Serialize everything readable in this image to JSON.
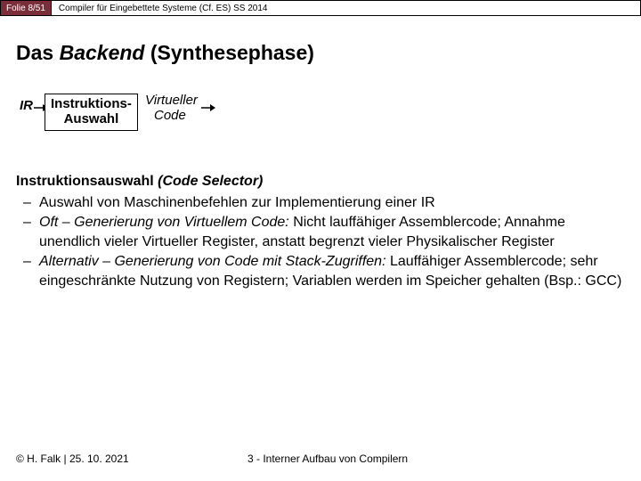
{
  "header": {
    "page_num": "Folie 8/51",
    "course": "Compiler für Eingebettete Systeme (Cf. ES) SS 2014"
  },
  "title_prefix": "Das ",
  "title_em": "Backend",
  "title_suffix": " (Synthesephase)",
  "diagram": {
    "ir": "IR",
    "box_line1": "Instruktions-",
    "box_line2": "Auswahl",
    "out_line1": "Virtueller",
    "out_line2": "Code"
  },
  "body": {
    "heading_plain": "Instruktionsauswahl ",
    "heading_em": "(Code Selector)",
    "items": [
      {
        "plain1": "Auswahl von Maschinenbefehlen zur Implementierung einer IR",
        "em": "",
        "plain2": ""
      },
      {
        "em": "Oft – Generierung von Virtuellem Code: ",
        "plain1": "Nicht lauffähiger Assemblercode; Annahme unendlich vieler Virtueller Register, anstatt begrenzt vieler Physikalischer Register",
        "plain2": ""
      },
      {
        "em": "Alternativ – Generierung von Code mit Stack-Zugriffen: ",
        "plain1": "Lauffähiger Assemblercode; sehr eingeschränkte Nutzung von Registern; Variablen werden im Speicher gehalten (Bsp.: GCC)",
        "plain2": ""
      }
    ]
  },
  "footer": {
    "left": "© H. Falk | 25. 10. 2021",
    "right": "3 - Interner Aufbau von Compilern"
  }
}
